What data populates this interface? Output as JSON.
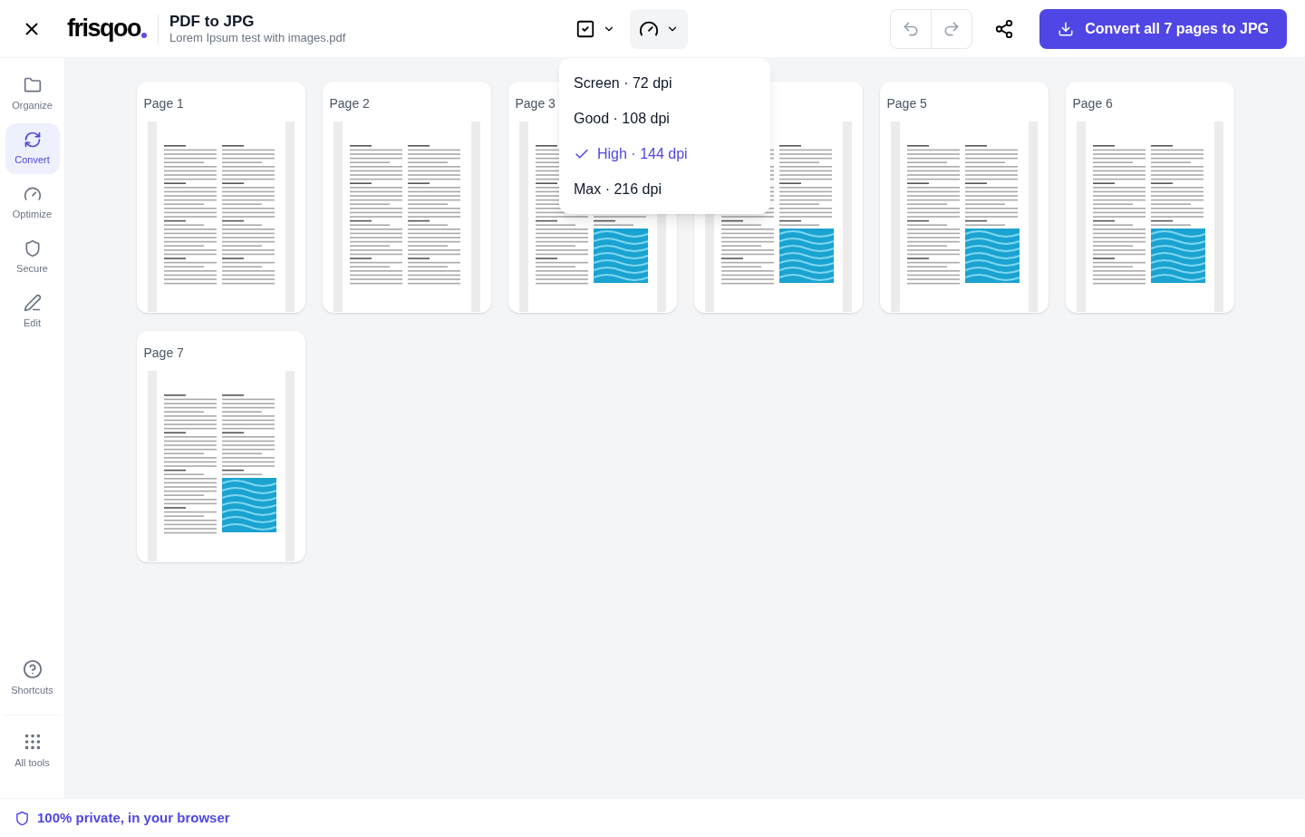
{
  "header": {
    "logo": "frisqoo",
    "title": "PDF to JPG",
    "filename": "Lorem Ipsum test with images.pdf",
    "convert_button": "Convert all 7 pages to JPG"
  },
  "sidebar": {
    "items": [
      {
        "label": "Organize",
        "selected": false
      },
      {
        "label": "Convert",
        "selected": true
      },
      {
        "label": "Optimize",
        "selected": false
      },
      {
        "label": "Secure",
        "selected": false
      },
      {
        "label": "Edit",
        "selected": false
      }
    ],
    "bottom_items": [
      {
        "label": "Shortcuts"
      },
      {
        "label": "All tools"
      }
    ]
  },
  "quality_menu": {
    "options": [
      {
        "label": "Screen · 72 dpi",
        "selected": false
      },
      {
        "label": "Good · 108 dpi",
        "selected": false
      },
      {
        "label": "High · 144 dpi",
        "selected": true
      },
      {
        "label": "Max · 216 dpi",
        "selected": false
      }
    ]
  },
  "pages": [
    {
      "label": "Page 1",
      "kind": "text"
    },
    {
      "label": "Page 2",
      "kind": "text"
    },
    {
      "label": "Page 3",
      "kind": "image"
    },
    {
      "kind": "image"
    },
    {
      "label": "Page 5",
      "kind": "image"
    },
    {
      "label": "Page 6",
      "kind": "image"
    },
    {
      "label": "Page 7",
      "kind": "image"
    }
  ],
  "footer": {
    "text": "100% private, in your browser"
  }
}
